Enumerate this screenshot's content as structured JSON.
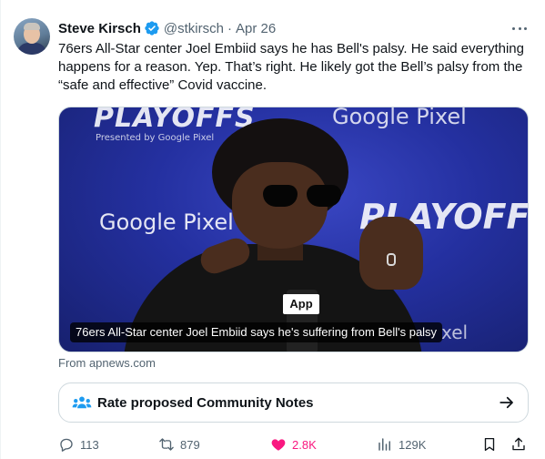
{
  "tweet": {
    "author_name": "Steve Kirsch",
    "handle": "@stkirsch",
    "separator": "·",
    "date": "Apr 26",
    "text": "76ers All-Star center Joel Embiid says he has Bell's palsy. He said everything happens for a reason. Yep. That’s right. He likely got the Bell’s palsy from the “safe and effective” Covid vaccine."
  },
  "media": {
    "caption": "76ers All-Star center Joel Embiid says he's suffering from Bell's palsy",
    "background_texts": {
      "playoffs_top": "PLAYOFFS",
      "presented": "Presented by Google Pixel",
      "google_top": "Google Pixel",
      "google_mid": "Google Pixel",
      "playoffs_right": "PLAYOFFS",
      "google_low": "xel",
      "mic_flag": "App"
    }
  },
  "source_label": "From apnews.com",
  "community_notes": {
    "label": "Rate proposed Community Notes"
  },
  "actions": {
    "replies": "113",
    "retweets": "879",
    "likes": "2.8K",
    "views": "129K"
  },
  "colors": {
    "verified": "#1d9bf0",
    "like": "#f91880",
    "muted_text": "#536471",
    "community_notes_icon": "#1d9bf0"
  },
  "icons": {
    "verified": "verified-badge-icon",
    "more": "more-horizontal-icon",
    "community_notes": "people-icon",
    "arrow": "arrow-right-icon",
    "reply": "reply-icon",
    "retweet": "retweet-icon",
    "like": "heart-filled-icon",
    "views": "views-chart-icon",
    "bookmark": "bookmark-icon",
    "share": "share-icon"
  }
}
